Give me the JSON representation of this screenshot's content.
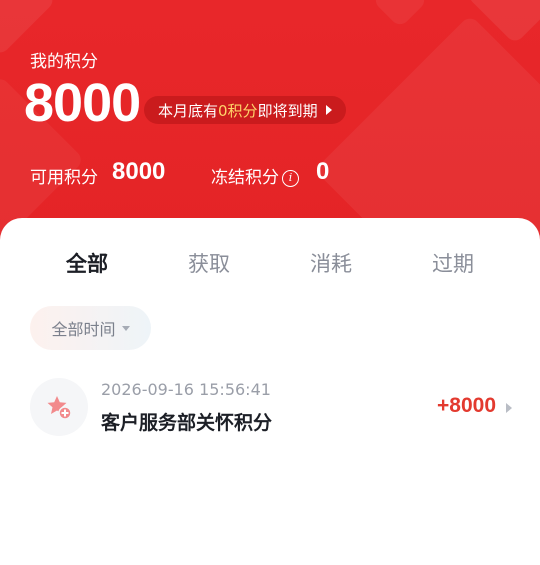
{
  "header": {
    "points_label": "我的积分",
    "points_total": "8000",
    "expire_notice": {
      "prefix": "本月底有",
      "highlight": "0积分",
      "suffix": "即将到期"
    },
    "available_label": "可用积分",
    "available_value": "8000",
    "frozen_label": "冻结积分",
    "frozen_value": "0",
    "info_icon_glyph": "i"
  },
  "tabs": [
    {
      "label": "全部",
      "active": true
    },
    {
      "label": "获取",
      "active": false
    },
    {
      "label": "消耗",
      "active": false
    },
    {
      "label": "过期",
      "active": false
    }
  ],
  "filter": {
    "label": "全部时间"
  },
  "records": [
    {
      "time": "2026-09-16 15:56:41",
      "title": "客户服务部关怀积分",
      "amount": "+8000",
      "icon": "star-plus-icon"
    }
  ],
  "colors": {
    "header_red": "#e8272a",
    "accent_blue": "#1a56e8",
    "amount_red": "#e33a2f",
    "highlight_yellow": "#ffd36a",
    "icon_pink": "#f28a8c"
  }
}
